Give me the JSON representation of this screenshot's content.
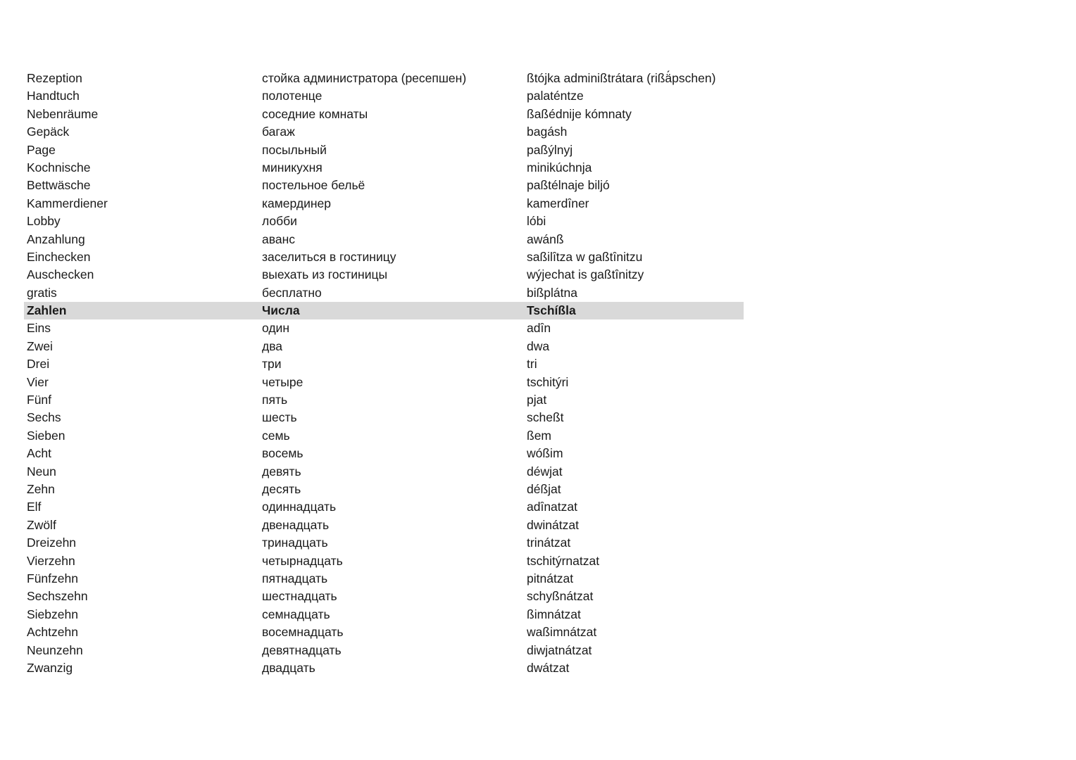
{
  "rows": [
    {
      "de": "Rezeption",
      "ru": "стойка администратора (ресепшен)",
      "tr": "ßtójka adminißtrátara (rißä́pschen)"
    },
    {
      "de": "Handtuch",
      "ru": "полотенце",
      "tr": "palaténtze"
    },
    {
      "de": "Nebenräume",
      "ru": "соседние комнаты",
      "tr": "ßaßédnije kómnaty"
    },
    {
      "de": "Gepäck",
      "ru": "багаж",
      "tr": "bagásh"
    },
    {
      "de": "Page",
      "ru": "посыльный",
      "tr": "paßýlnyj"
    },
    {
      "de": "Kochnische",
      "ru": "миникухня",
      "tr": "minikúchnja"
    },
    {
      "de": "Bettwäsche",
      "ru": "постельное бельё",
      "tr": "paßtélnaje biljó"
    },
    {
      "de": "Kammerdiener",
      "ru": "камердинер",
      "tr": "kamerdȋner"
    },
    {
      "de": "Lobby",
      "ru": "лобби",
      "tr": "lóbi"
    },
    {
      "de": "Anzahlung",
      "ru": "аванс",
      "tr": "awánß"
    },
    {
      "de": "Einchecken",
      "ru": "заселиться в гостиницу",
      "tr": "saßilȋtza w gaßtȋnitzu"
    },
    {
      "de": "Auschecken",
      "ru": "выехать из гостиницы",
      "tr": "wýjechat is gaßtȋnitzy"
    },
    {
      "de": "gratis",
      "ru": "бесплатно",
      "tr": "bißplátna"
    },
    {
      "de": "Zahlen",
      "ru": "Числа",
      "tr": "Tschíßla",
      "section": true
    },
    {
      "de": "Eins",
      "ru": "один",
      "tr": "adȋn"
    },
    {
      "de": "Zwei",
      "ru": "два",
      "tr": "dwa"
    },
    {
      "de": "Drei",
      "ru": "три",
      "tr": "tri"
    },
    {
      "de": "Vier",
      "ru": "четыре",
      "tr": "tschitýri"
    },
    {
      "de": "Fünf",
      "ru": "пять",
      "tr": "pjat"
    },
    {
      "de": "Sechs",
      "ru": "шесть",
      "tr": "scheßt"
    },
    {
      "de": "Sieben",
      "ru": "семь",
      "tr": "ßem"
    },
    {
      "de": "Acht",
      "ru": "восемь",
      "tr": "wóßim"
    },
    {
      "de": "Neun",
      "ru": "девять",
      "tr": "déwjat"
    },
    {
      "de": "Zehn",
      "ru": "десять",
      "tr": "déßjat"
    },
    {
      "de": "Elf",
      "ru": "одиннадцать",
      "tr": "adȋnatzat"
    },
    {
      "de": "Zwölf",
      "ru": "двенадцать",
      "tr": "dwinátzat"
    },
    {
      "de": "Dreizehn",
      "ru": "тринадцать",
      "tr": "trinátzat"
    },
    {
      "de": "Vierzehn",
      "ru": "четырнадцать",
      "tr": "tschitýrnatzat"
    },
    {
      "de": "Fünfzehn",
      "ru": "пятнадцать",
      "tr": "pitnátzat"
    },
    {
      "de": "Sechszehn",
      "ru": "шестнадцать",
      "tr": "schyßnátzat"
    },
    {
      "de": "Siebzehn",
      "ru": "семнадцать",
      "tr": "ßimnátzat"
    },
    {
      "de": "Achtzehn",
      "ru": "восемнадцать",
      "tr": "waßimnátzat"
    },
    {
      "de": "Neunzehn",
      "ru": "девятнадцать",
      "tr": "diwjatnátzat"
    },
    {
      "de": "Zwanzig",
      "ru": "двадцать",
      "tr": "dwátzat"
    }
  ],
  "colors": {
    "section_background": "#d9d9d9",
    "text": "#1a1a1a"
  }
}
